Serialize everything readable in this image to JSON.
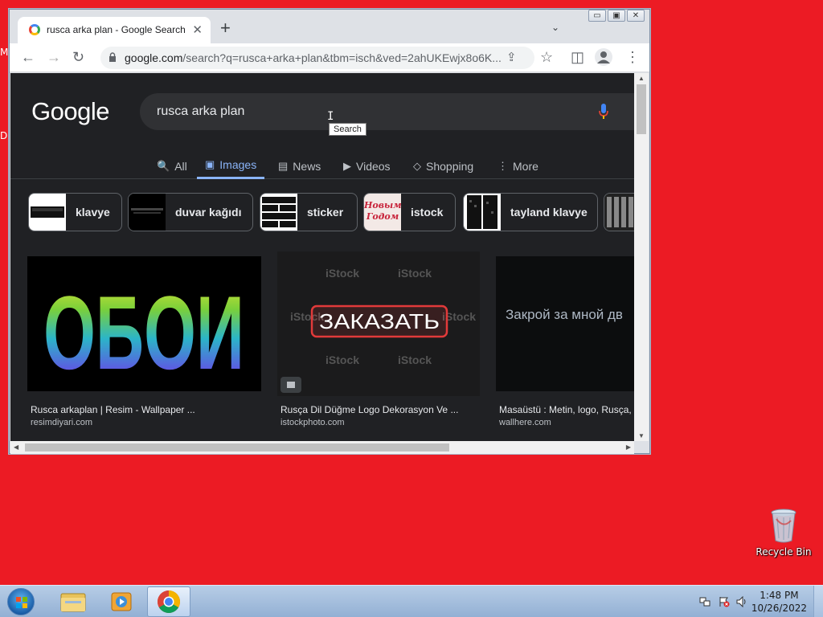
{
  "desktop": {
    "edge_labels": [
      "M",
      "D"
    ],
    "recycle_bin": {
      "label": "Recycle Bin",
      "icon": "recycle-bin-icon"
    }
  },
  "taskbar": {
    "clock_time": "1:48 PM",
    "clock_date": "10/26/2022",
    "pinned": [
      {
        "name": "windows-explorer",
        "icon": "folder-icon"
      },
      {
        "name": "media-player",
        "icon": "media-player-icon"
      },
      {
        "name": "chrome",
        "icon": "chrome-icon",
        "active": true
      }
    ]
  },
  "browser": {
    "window_controls": {
      "minimize": "▭",
      "maximize": "▣",
      "close": "✕"
    },
    "tab_title": "rusca arka plan - Google Search",
    "tab_close": "✕",
    "new_tab": "+",
    "tab_menu": "⌄",
    "url_host": "google.com",
    "url_rest": "/search?q=rusca+arka+plan&tbm=isch&ved=2ahUKEwjx8o6K...",
    "nav": {
      "back": "←",
      "forward": "→",
      "reload": "↻"
    },
    "toolbar_icons": {
      "share": "⇪",
      "star": "☆",
      "sidepanel": "◫",
      "menu": "⋮"
    }
  },
  "page": {
    "logo": "Google",
    "search_query": "rusca arka plan",
    "tooltip": "Search",
    "tabs": [
      {
        "label": "All",
        "icon": "🔍"
      },
      {
        "label": "Images",
        "icon": "▣",
        "selected": true
      },
      {
        "label": "News",
        "icon": "▤"
      },
      {
        "label": "Videos",
        "icon": "▶"
      },
      {
        "label": "Shopping",
        "icon": "◇"
      },
      {
        "label": "More",
        "icon": "⋮"
      }
    ],
    "chips": [
      {
        "label": "klavye"
      },
      {
        "label": "duvar kağıdı"
      },
      {
        "label": "sticker"
      },
      {
        "label": "istock"
      },
      {
        "label": "tayland klavye"
      }
    ],
    "results": [
      {
        "title": "Rusca arkaplan | Resim - Wallpaper ...",
        "source": "resimdiyari.com",
        "image_text": "ОБОИ"
      },
      {
        "title": "Rusça Dil Düğme Logo Dekorasyon Ve ...",
        "source": "istockphoto.com",
        "image_text": "ЗАКАЗАТЬ",
        "watermark": "iStock"
      },
      {
        "title": "Masaüstü : Metin, logo, Rusça, ...",
        "source": "wallhere.com",
        "image_text": "Закрой за мной дв"
      }
    ],
    "chip_thumb_text": {
      "istock": "Новым Годом"
    }
  },
  "colors": {
    "desktop_bg": "#ec1b24",
    "page_bg": "#202124",
    "accent": "#8ab4f8"
  }
}
